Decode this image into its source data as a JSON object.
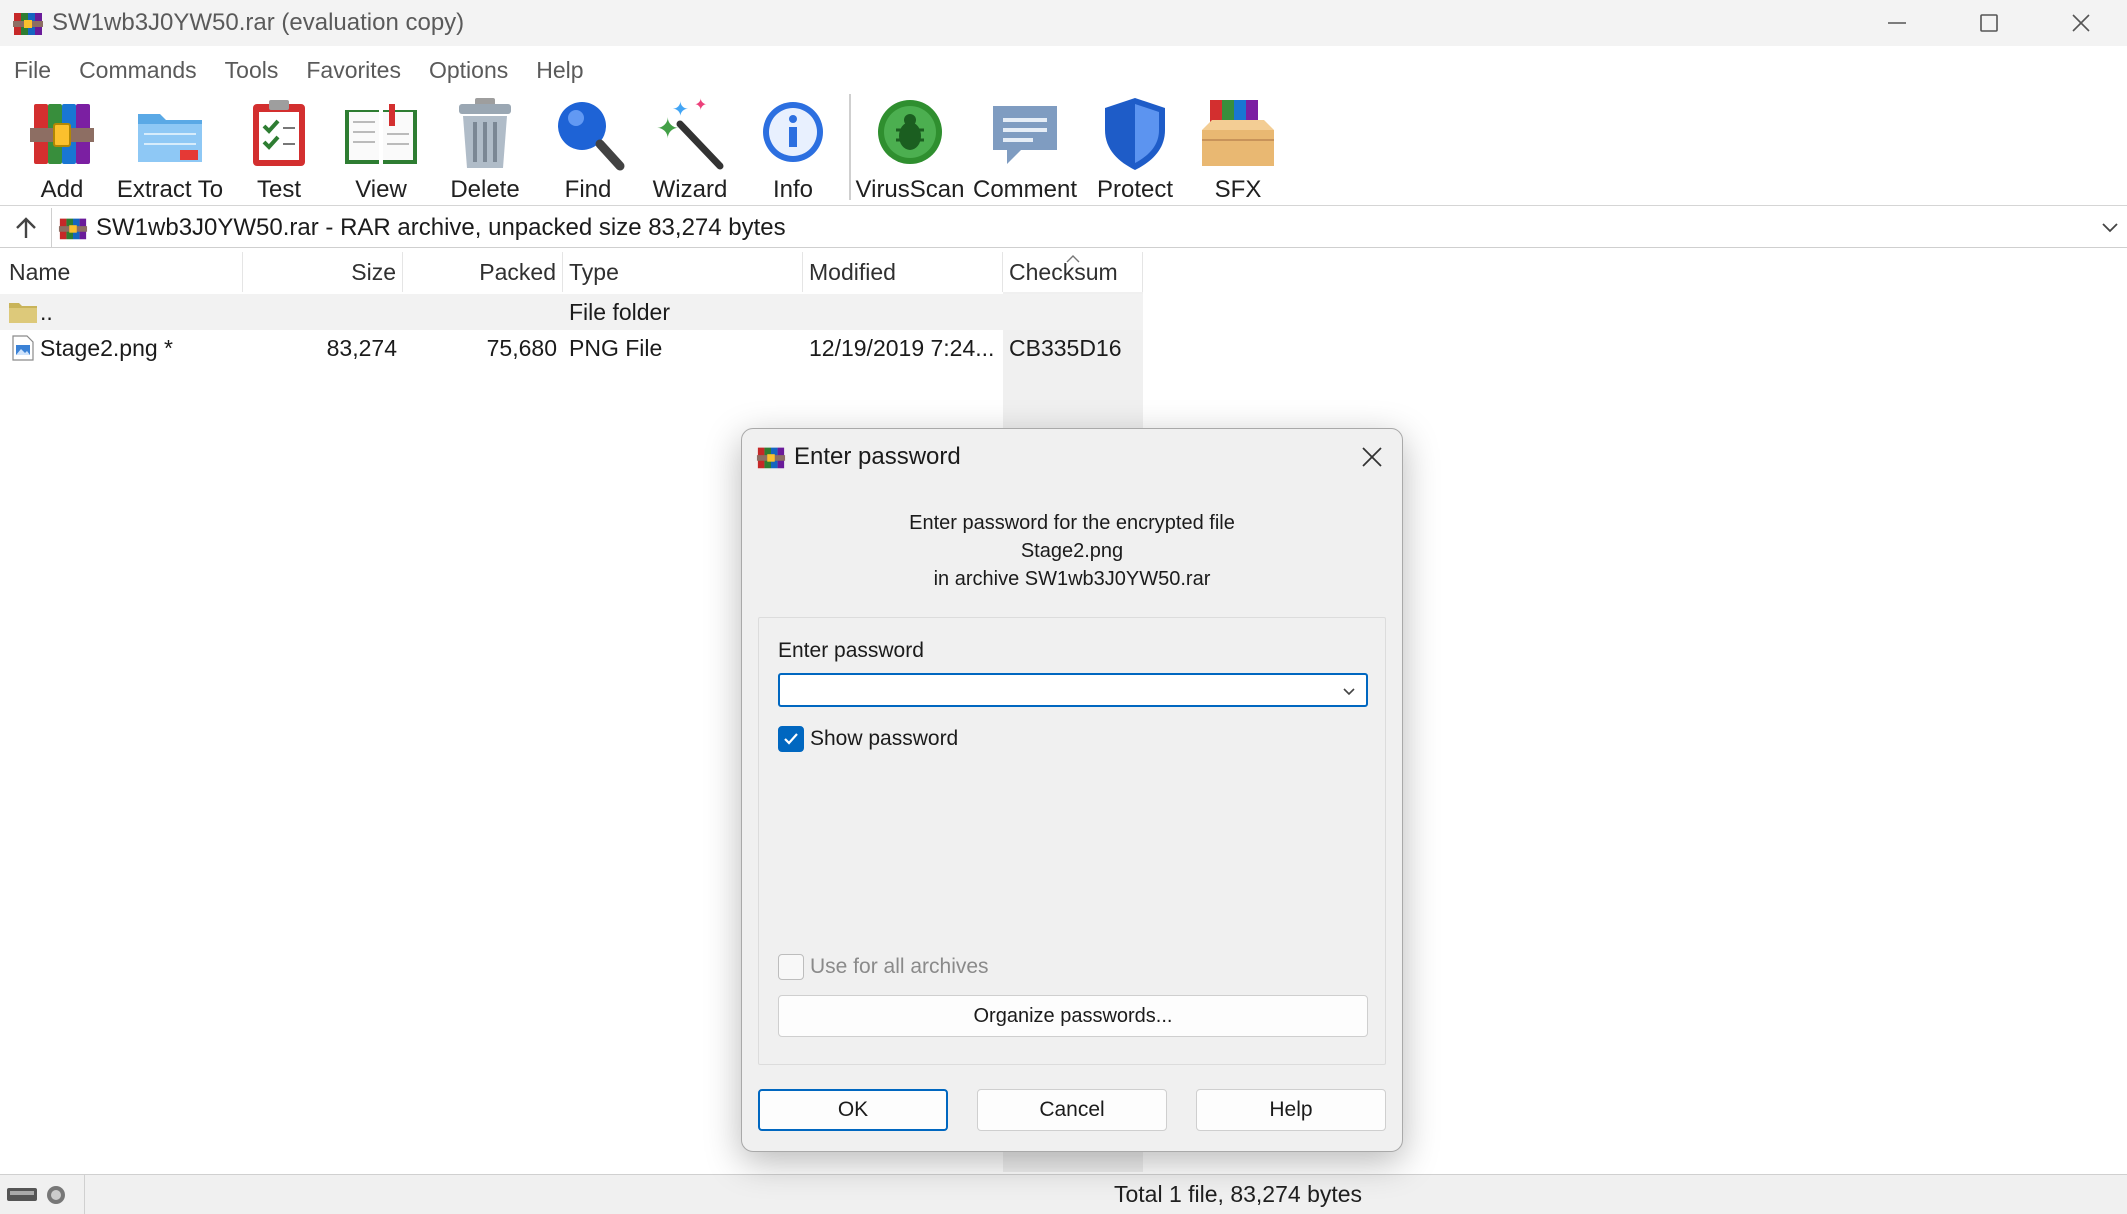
{
  "window": {
    "title": "SW1wb3J0YW50.rar (evaluation copy)"
  },
  "menu": [
    "File",
    "Commands",
    "Tools",
    "Favorites",
    "Options",
    "Help"
  ],
  "toolbar": {
    "add": "Add",
    "extract_to": "Extract To",
    "test": "Test",
    "view": "View",
    "delete": "Delete",
    "find": "Find",
    "wizard": "Wizard",
    "info": "Info",
    "virusscan": "VirusScan",
    "comment": "Comment",
    "protect": "Protect",
    "sfx": "SFX"
  },
  "address": {
    "text": "SW1wb3J0YW50.rar - RAR archive, unpacked size 83,274 bytes"
  },
  "columns": {
    "name": "Name",
    "size": "Size",
    "packed": "Packed",
    "type": "Type",
    "modified": "Modified",
    "checksum": "Checksum"
  },
  "rows": [
    {
      "name": "..",
      "size": "",
      "packed": "",
      "type": "File folder",
      "modified": "",
      "checksum": ""
    },
    {
      "name": "Stage2.png *",
      "size": "83,274",
      "packed": "75,680",
      "type": "PNG File",
      "modified": "12/19/2019 7:24...",
      "checksum": "CB335D16"
    }
  ],
  "status": {
    "text": "Total 1 file, 83,274 bytes"
  },
  "dialog": {
    "title": "Enter password",
    "message_line1": "Enter password for the encrypted file",
    "message_line2": "Stage2.png",
    "message_line3": "in archive SW1wb3J0YW50.rar",
    "password_label": "Enter password",
    "password_value": "",
    "show_password_label": "Show password",
    "show_password_checked": true,
    "use_for_all_label": "Use for all archives",
    "use_for_all_checked": false,
    "organize_button": "Organize passwords...",
    "ok_button": "OK",
    "cancel_button": "Cancel",
    "help_button": "Help"
  },
  "colors": {
    "accent": "#0067c0",
    "checksum_band": "#f0f0f0"
  }
}
